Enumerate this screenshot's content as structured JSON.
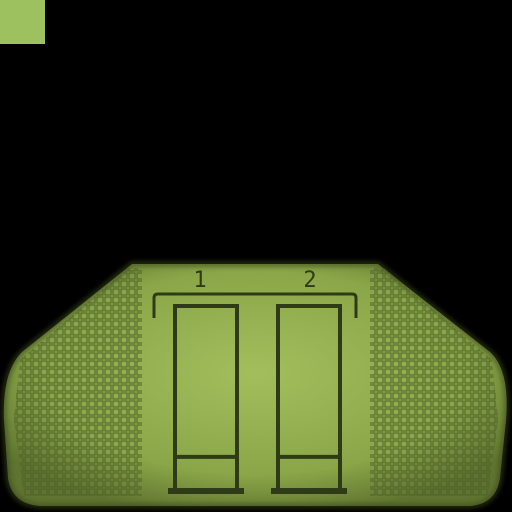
{
  "colors": {
    "background": "#000000",
    "lcd_face": "#8aa648",
    "lcd_face_light": "#a3be5c",
    "lcd_dark": "#2f3a17",
    "lcd_grid": "#4d6128",
    "corner_swatch": "#9cc15e"
  },
  "lcd": {
    "top_labels": [
      "1",
      "2"
    ],
    "slots": [
      {
        "label": "1",
        "fill_fraction": 0.18
      },
      {
        "label": "2",
        "fill_fraction": 0.18
      }
    ]
  }
}
